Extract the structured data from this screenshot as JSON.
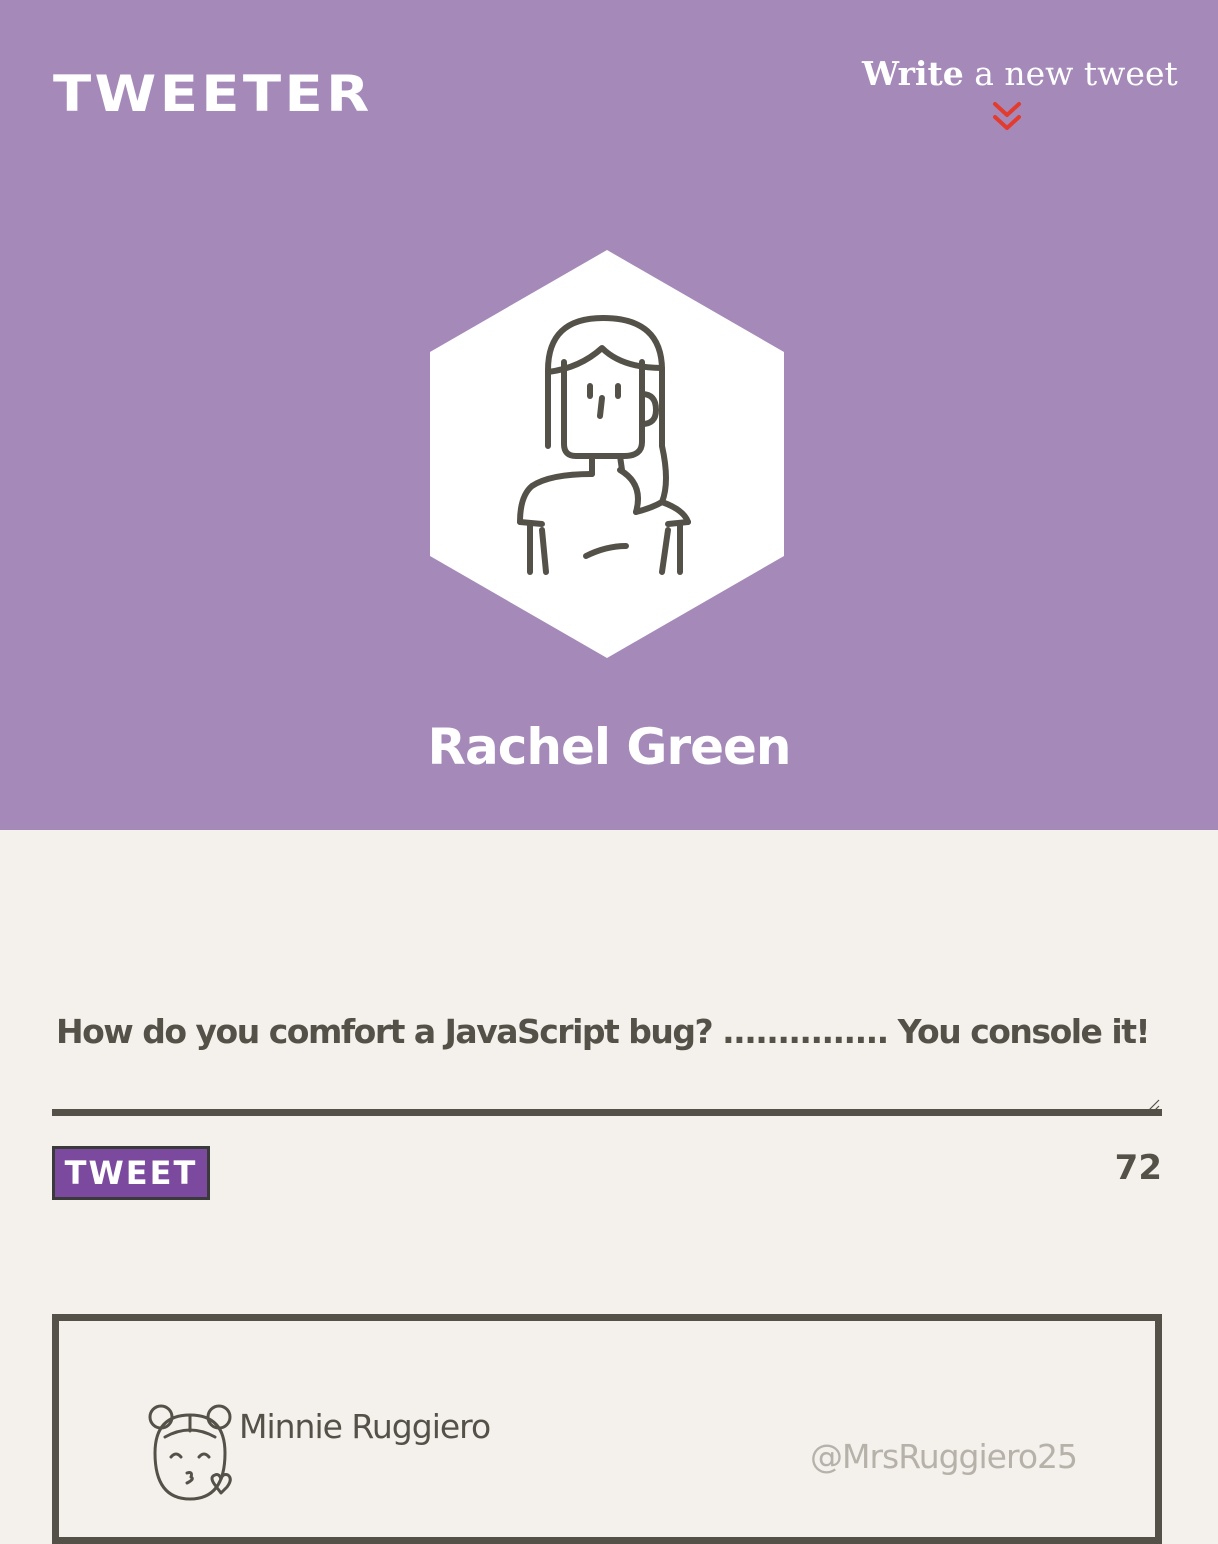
{
  "app": {
    "logo": "TWEETER"
  },
  "nav": {
    "compose_bold": "Write",
    "compose_rest": " a new tweet",
    "compose_icon": "double-chevron-down-icon"
  },
  "profile": {
    "name": "Rachel Green",
    "avatar_icon": "woman-avatar-icon"
  },
  "compose": {
    "text": "How do you comfort a JavaScript bug? ............... You console it!",
    "button_label": "TWEET",
    "char_count": "72"
  },
  "feed": {
    "tweets": [
      {
        "name": "Minnie Ruggiero",
        "handle": "@MrsRuggiero25",
        "avatar_icon": "girl-kiss-avatar-icon"
      }
    ]
  },
  "colors": {
    "header_bg": "#a58ab9",
    "page_bg": "#f4f1ec",
    "text_dark": "#545149",
    "accent_purple": "#7b4a9f",
    "arrow_red": "#e33b2e",
    "handle_gray": "#b6b2aa"
  }
}
